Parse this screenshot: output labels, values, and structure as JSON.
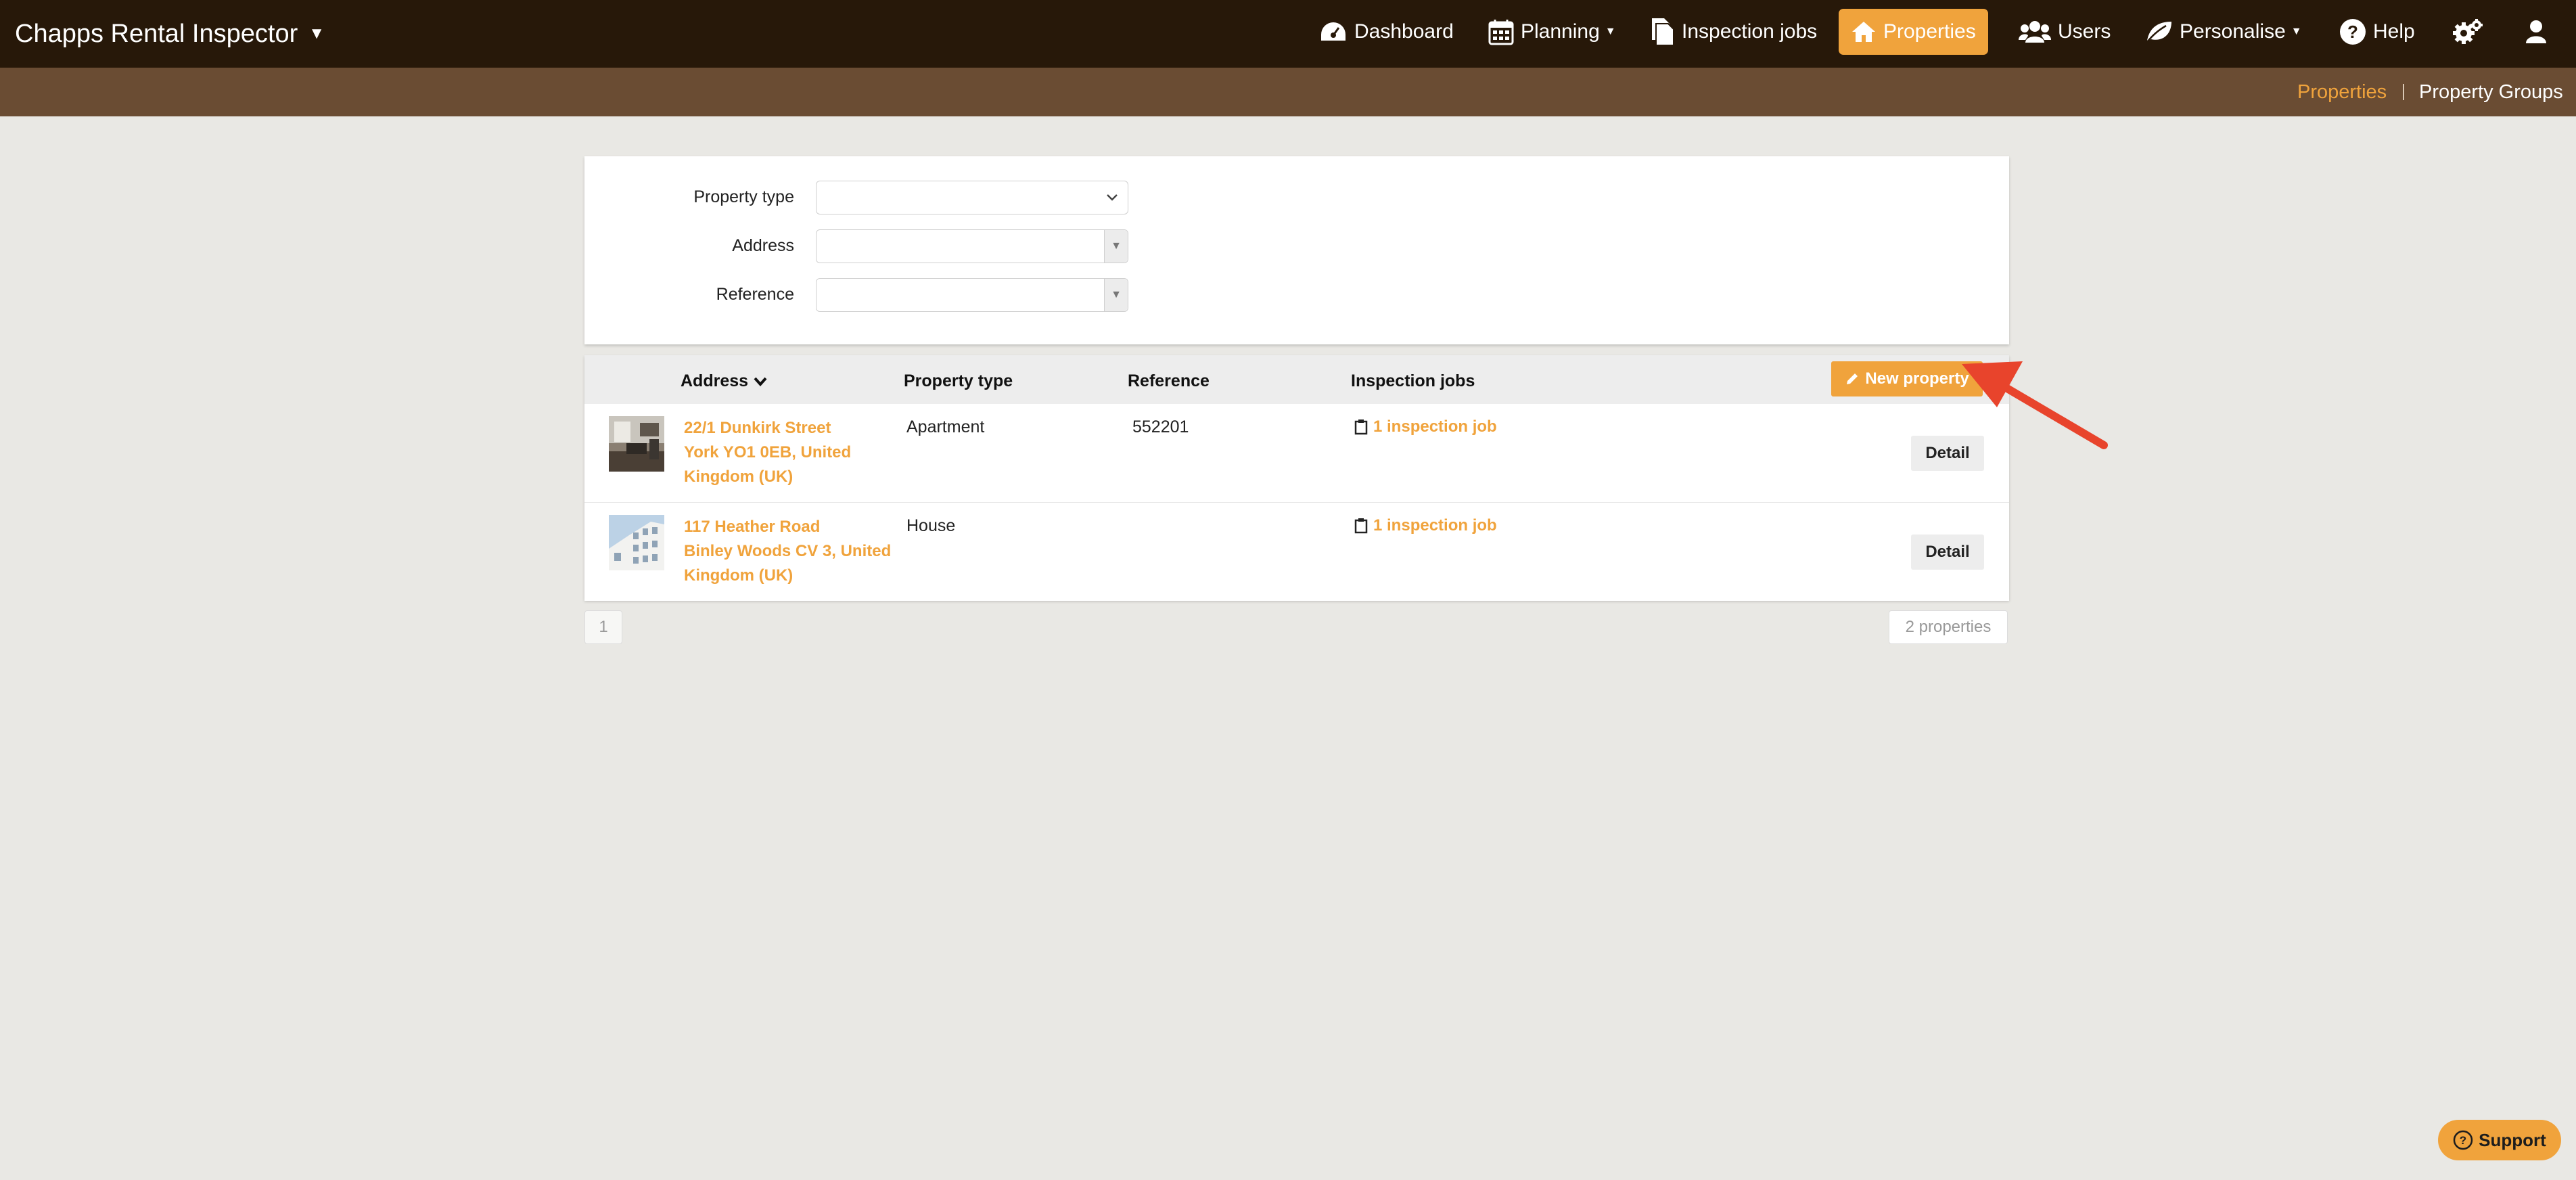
{
  "app": {
    "title": "Chapps Rental Inspector"
  },
  "nav": {
    "dashboard": "Dashboard",
    "planning": "Planning",
    "inspection_jobs": "Inspection jobs",
    "properties": "Properties",
    "users": "Users",
    "personalise": "Personalise",
    "help": "Help"
  },
  "subnav": {
    "properties": "Properties",
    "property_groups": "Property Groups"
  },
  "filters": {
    "property_type_label": "Property type",
    "address_label": "Address",
    "reference_label": "Reference"
  },
  "table": {
    "headers": {
      "address": "Address",
      "property_type": "Property type",
      "reference": "Reference",
      "inspection_jobs": "Inspection jobs"
    },
    "new_property_label": "New property",
    "detail_label": "Detail",
    "rows": [
      {
        "address_line1": "22/1 Dunkirk Street",
        "address_line2": "York YO1 0EB, United",
        "address_line3": "Kingdom (UK)",
        "property_type": "Apartment",
        "reference": "552201",
        "jobs": "1 inspection job"
      },
      {
        "address_line1": "117 Heather Road",
        "address_line2": "Binley Woods CV 3, United",
        "address_line3": "Kingdom (UK)",
        "property_type": "House",
        "reference": "",
        "jobs": "1 inspection job"
      }
    ]
  },
  "pager": {
    "page": "1",
    "count": "2 properties"
  },
  "support": {
    "label": "Support"
  },
  "colors": {
    "topbar": "#271809",
    "subbar": "#6a4c33",
    "accent": "#f0a33c",
    "background": "#e9e8e4"
  },
  "icons": [
    "dashboard-icon",
    "calendar-icon",
    "documents-icon",
    "home-icon",
    "users-icon",
    "leaf-icon",
    "help-icon",
    "settings-icon",
    "user-icon",
    "pencil-icon",
    "clipboard-icon",
    "question-icon"
  ]
}
